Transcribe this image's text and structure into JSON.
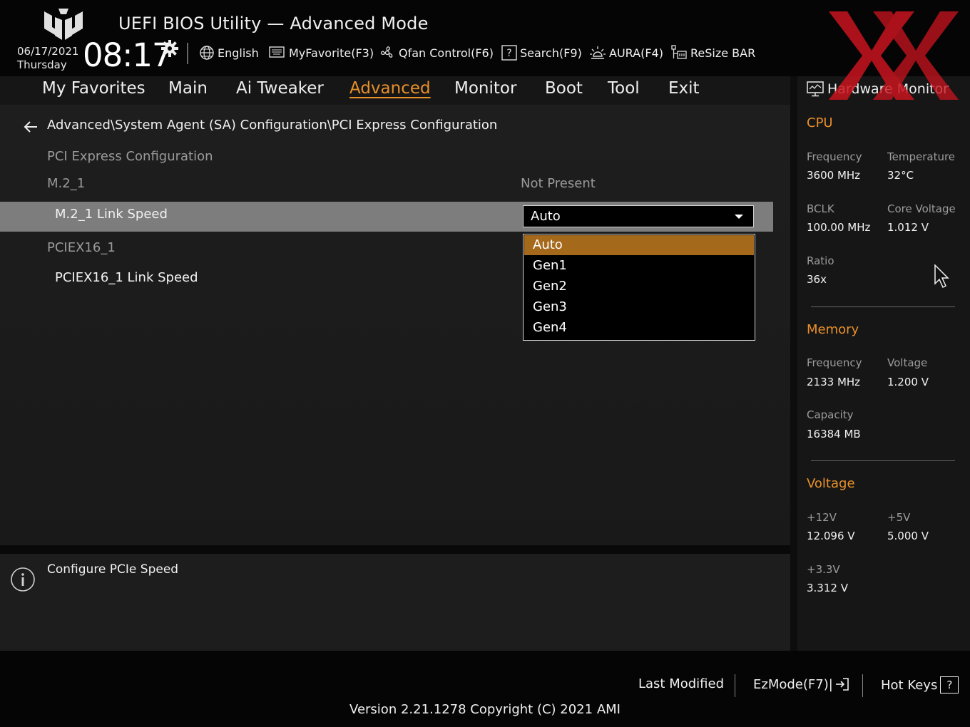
{
  "header": {
    "title": "UEFI BIOS Utility — Advanced Mode",
    "date": "06/17/2021",
    "day": "Thursday",
    "time": "08:17",
    "tools": [
      {
        "icon": "globe-icon",
        "label": "English"
      },
      {
        "icon": "keyboard-icon",
        "label": "MyFavorite(F3)"
      },
      {
        "icon": "fan-icon",
        "label": "Qfan Control(F6)"
      },
      {
        "icon": "help-box-icon",
        "label": "Search(F9)"
      },
      {
        "icon": "aura-light-icon",
        "label": "AURA(F4)"
      },
      {
        "icon": "resize-bar-icon",
        "label": "ReSize BAR"
      }
    ]
  },
  "tabs": [
    {
      "label": "My Favorites",
      "active": false
    },
    {
      "label": "Main",
      "active": false
    },
    {
      "label": "Ai Tweaker",
      "active": false
    },
    {
      "label": "Advanced",
      "active": true
    },
    {
      "label": "Monitor",
      "active": false
    },
    {
      "label": "Boot",
      "active": false
    },
    {
      "label": "Tool",
      "active": false
    },
    {
      "label": "Exit",
      "active": false
    }
  ],
  "content": {
    "breadcrumb": "Advanced\\System Agent (SA) Configuration\\PCI Express Configuration",
    "section_title": "PCI Express Configuration",
    "m2_header": "M.2_1",
    "m2_status": "Not Present",
    "m2_link_speed_label": "M.2_1 Link Speed",
    "pciex_header": "PCIEX16_1",
    "pciex_link_speed_label": "PCIEX16_1 Link Speed",
    "dropdown_value": "Auto",
    "dropdown_options": [
      "Auto",
      "Gen1",
      "Gen2",
      "Gen3",
      "Gen4"
    ],
    "dropdown_selected_index": 0
  },
  "help": {
    "text": "Configure PCIe Speed"
  },
  "hardware_monitor": {
    "title": "Hardware Monitor",
    "cpu": {
      "section": "CPU",
      "frequency_label": "Frequency",
      "frequency_value": "3600 MHz",
      "temperature_label": "Temperature",
      "temperature_value": "32°C",
      "bclk_label": "BCLK",
      "bclk_value": "100.00 MHz",
      "core_voltage_label": "Core Voltage",
      "core_voltage_value": "1.012 V",
      "ratio_label": "Ratio",
      "ratio_value": "36x"
    },
    "memory": {
      "section": "Memory",
      "frequency_label": "Frequency",
      "frequency_value": "2133 MHz",
      "voltage_label": "Voltage",
      "voltage_value": "1.200 V",
      "capacity_label": "Capacity",
      "capacity_value": "16384 MB"
    },
    "voltage": {
      "section": "Voltage",
      "v12_label": "+12V",
      "v12_value": "12.096 V",
      "v5_label": "+5V",
      "v5_value": "5.000 V",
      "v33_label": "+3.3V",
      "v33_value": "3.312 V"
    }
  },
  "footer": {
    "last_modified": "Last Modified",
    "ezmode": "EzMode(F7)|",
    "hot_keys": "Hot Keys",
    "hot_keys_badge": "?",
    "version": "Version 2.21.1278 Copyright (C) 2021 AMI"
  },
  "colors": {
    "accent": "#e8902a",
    "selected_option": "#a5691c",
    "selected_row": "#7d7d7d",
    "watermark": "#c8141e"
  }
}
